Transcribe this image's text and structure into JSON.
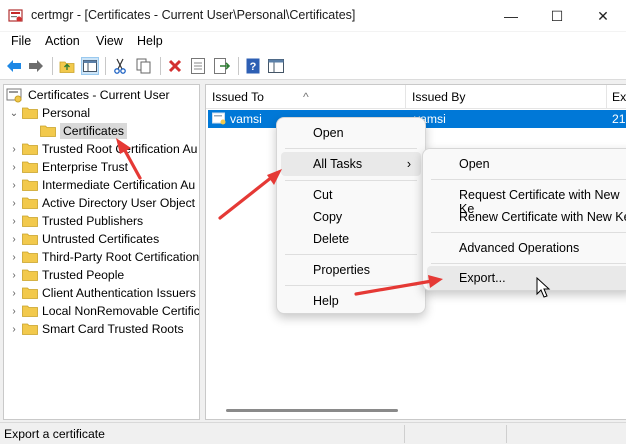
{
  "window": {
    "title": "certmgr - [Certificates - Current User\\Personal\\Certificates]",
    "minimize_glyph": "—",
    "maximize_glyph": "☐",
    "close_glyph": "✕"
  },
  "menubar": [
    "File",
    "Action",
    "View",
    "Help"
  ],
  "toolbar": [
    "back-icon",
    "forward-icon",
    "up-folder-icon",
    "show-hide-tree-icon",
    "cut-icon",
    "copy-icon",
    "delete-icon",
    "properties-icon",
    "export-list-icon",
    "help-icon",
    "console-icon"
  ],
  "tree": {
    "root": "Certificates - Current User",
    "personal": "Personal",
    "certificates": "Certificates",
    "stores": [
      "Trusted Root Certification Au",
      "Enterprise Trust",
      "Intermediate Certification Au",
      "Active Directory User Object",
      "Trusted Publishers",
      "Untrusted Certificates",
      "Third-Party Root Certification",
      "Trusted People",
      "Client Authentication Issuers",
      "Local NonRemovable Certific",
      "Smart Card Trusted Roots"
    ]
  },
  "list": {
    "columns": [
      "Issued To",
      "Issued By",
      "Ex"
    ],
    "rows": [
      {
        "issued_to": "vamsi",
        "issued_by": "vamsi",
        "expiry": "21"
      }
    ]
  },
  "context_menu": {
    "open": "Open",
    "all_tasks": "All Tasks",
    "cut": "Cut",
    "copy": "Copy",
    "delete": "Delete",
    "properties": "Properties",
    "help": "Help"
  },
  "submenu": {
    "open": "Open",
    "request": "Request Certificate with New Ke",
    "renew": "Renew Certificate with New Ke",
    "advanced": "Advanced Operations",
    "export": "Export..."
  },
  "status": "Export a certificate",
  "colors": {
    "selection": "#0078d7",
    "annotation_arrow": "#e53935",
    "folder": "#f2c94c"
  }
}
